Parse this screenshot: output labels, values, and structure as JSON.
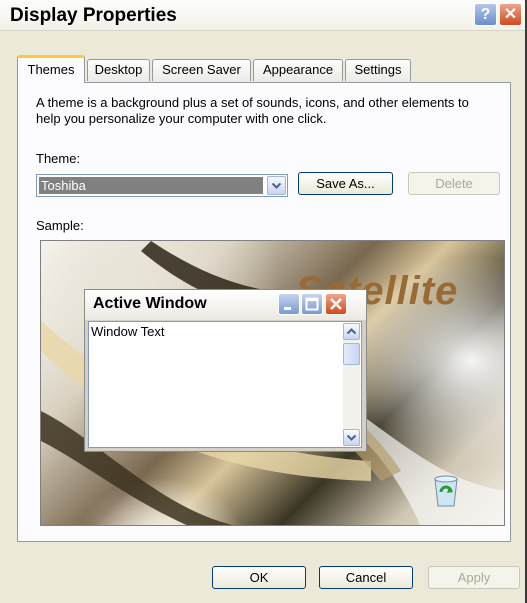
{
  "window": {
    "title": "Display Properties",
    "help_glyph": "?",
    "close_glyph": "✕"
  },
  "tabs": [
    {
      "label": "Themes",
      "active": true
    },
    {
      "label": "Desktop"
    },
    {
      "label": "Screen Saver"
    },
    {
      "label": "Appearance"
    },
    {
      "label": "Settings"
    }
  ],
  "themes_tab": {
    "description": "A theme is a background plus a set of sounds, icons, and other elements to help you personalize your computer with one click.",
    "theme_label": "Theme:",
    "theme_value": "Toshiba",
    "save_as_label": "Save As...",
    "delete_label": "Delete",
    "sample_label": "Sample:"
  },
  "sample": {
    "wallpaper_text": "Satellite",
    "active_window_title": "Active Window",
    "window_text": "Window Text"
  },
  "footer": {
    "ok": "OK",
    "cancel": "Cancel",
    "apply": "Apply"
  },
  "colors": {
    "dialog_bg": "#ECE9D8",
    "tab_highlight": "#ffc83c",
    "close_red": "#d1481c"
  }
}
